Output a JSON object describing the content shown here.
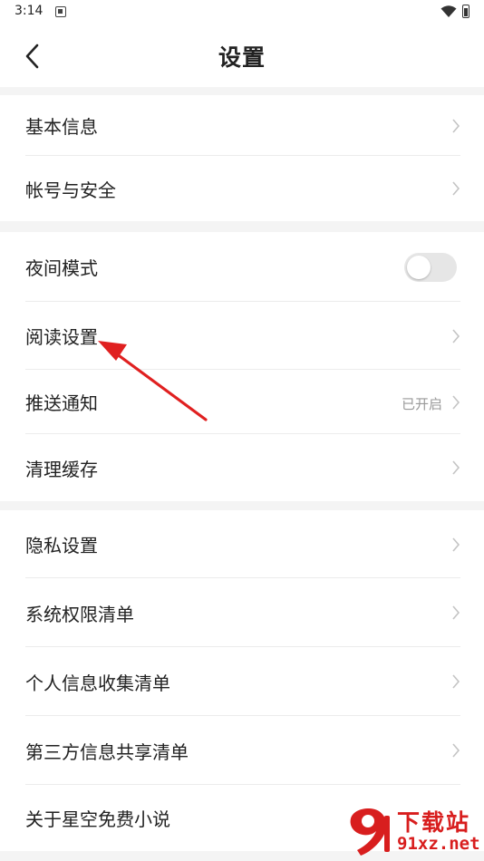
{
  "status_bar": {
    "time": "3:14"
  },
  "header": {
    "title": "设置"
  },
  "groups": [
    {
      "items": [
        {
          "label": "基本信息"
        },
        {
          "label": "帐号与安全"
        }
      ]
    },
    {
      "items": [
        {
          "label": "夜间模式",
          "toggle": false
        },
        {
          "label": "阅读设置"
        },
        {
          "label": "推送通知",
          "value": "已开启"
        },
        {
          "label": "清理缓存"
        }
      ]
    },
    {
      "items": [
        {
          "label": "隐私设置"
        },
        {
          "label": "系统权限清单"
        },
        {
          "label": "个人信息收集清单"
        },
        {
          "label": "第三方信息共享清单"
        },
        {
          "label": "关于星空免费小说"
        }
      ]
    }
  ],
  "annotation": {
    "color": "#e02020",
    "target": "阅读设置"
  },
  "watermark": {
    "text": "下载站",
    "domain": "91xz.net",
    "color": "#d81e1e"
  }
}
